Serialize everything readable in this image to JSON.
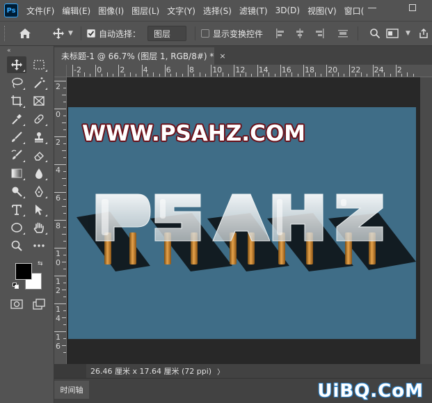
{
  "app": {
    "logo": "Ps"
  },
  "menu": [
    "文件(F)",
    "编辑(E)",
    "图像(I)",
    "图层(L)",
    "文字(Y)",
    "选择(S)",
    "滤镜(T)",
    "3D(D)",
    "视图(V)",
    "窗口("
  ],
  "options": {
    "auto_select_label": "自动选择：",
    "auto_select_checked": true,
    "layer_select_value": "图层",
    "show_transform_label": "显示变换控件",
    "show_transform_checked": false
  },
  "toolbar": {
    "collapse_label": "«",
    "foreground": "#000000",
    "background": "#ffffff"
  },
  "document": {
    "tab_title": "未标题-1 @ 66.7% (图层 1, RGB/8#) *",
    "close_label": "×"
  },
  "rulers": {
    "h_labels": [
      "-2",
      "0",
      "2",
      "4",
      "6",
      "8",
      "10",
      "12",
      "14",
      "16",
      "18",
      "20",
      "22",
      "24",
      "2"
    ],
    "v_labels": [
      "2",
      "0",
      "2",
      "4",
      "6",
      "8",
      "1 0",
      "1 2",
      "1 4",
      "1 6"
    ]
  },
  "canvas": {
    "url_text": "WWW.PSAHZ.COM",
    "bg_color": "#3f6d87",
    "letters": [
      "P",
      "S",
      "A",
      "H",
      "Z"
    ]
  },
  "status": {
    "text": "26.46 厘米 x 17.64 厘米 (72 ppi)",
    "arrow": "〉"
  },
  "timeline": {
    "tab_label": "时间轴"
  },
  "watermark": {
    "text": "UiBQ.CoM"
  }
}
